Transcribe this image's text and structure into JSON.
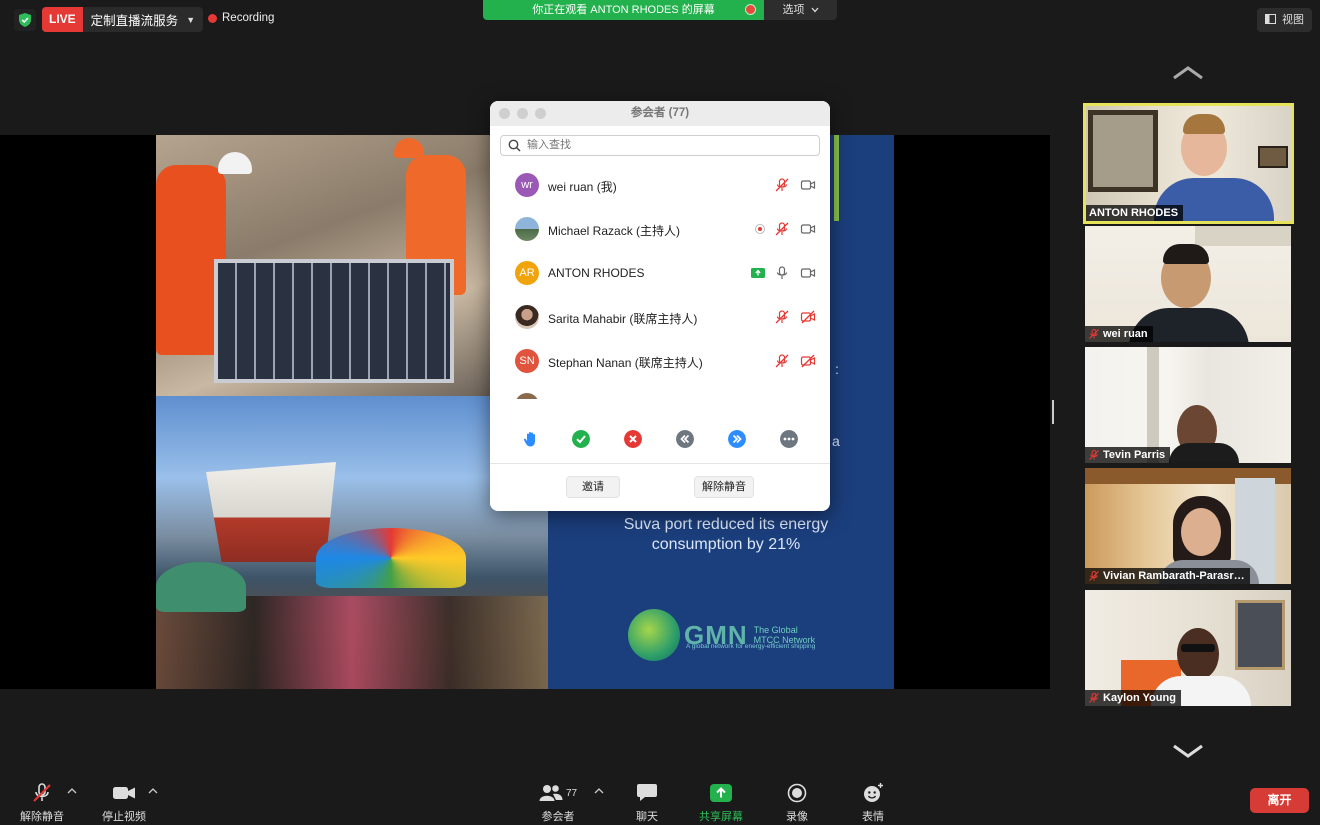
{
  "topbar": {
    "live_label": "LIVE",
    "stream_service": "定制直播流服务",
    "recording": "Recording",
    "viewing_banner": "你正在观看 ANTON RHODES 的屏幕",
    "options": "选项",
    "view_button": "视图"
  },
  "slide": {
    "text": "Suva port reduced its energy consumption by 21%",
    "partial_a": "a",
    "partial_colon": ":",
    "logo_text": "GMN",
    "logo_line1": "The Global",
    "logo_line2": "MTCC Network",
    "logo_tagline": "A global network for energy-efficient shipping"
  },
  "participants": {
    "title": "参会者 (77)",
    "search_placeholder": "输入查找",
    "list": [
      {
        "initials": "wr",
        "name": "wei ruan (我)",
        "avatar_color": "#9b59b6"
      },
      {
        "initials": "",
        "name": "Michael Razack (主持人)",
        "avatar_color": "#6a8fb5"
      },
      {
        "initials": "AR",
        "name": "ANTON RHODES",
        "avatar_color": "#f0a30a"
      },
      {
        "initials": "",
        "name": "Sarita Mahabir (联席主持人)",
        "avatar_color": "#b48a78"
      },
      {
        "initials": "SN",
        "name": "Stephan Nanan (联席主持人)",
        "avatar_color": "#e0533d"
      }
    ],
    "invite_button": "邀请",
    "unmute_button": "解除静音"
  },
  "videos": [
    {
      "name": "ANTON RHODES",
      "muted": false
    },
    {
      "name": "wei ruan",
      "muted": true
    },
    {
      "name": "Tevin Parris",
      "muted": true
    },
    {
      "name": "Vivian Rambarath-Parasr…",
      "muted": true
    },
    {
      "name": "Kaylon Young",
      "muted": true
    }
  ],
  "toolbar": {
    "unmute": "解除静音",
    "stop_video": "停止视频",
    "participants": "参会者",
    "participants_count": "77",
    "chat": "聊天",
    "share_screen": "共享屏幕",
    "record": "录像",
    "reactions": "表情",
    "leave": "离开"
  },
  "colors": {
    "accent_green": "#23b14d",
    "live_red": "#e53935",
    "leave_red": "#d63c35",
    "active_speaker": "#e6e35a"
  }
}
